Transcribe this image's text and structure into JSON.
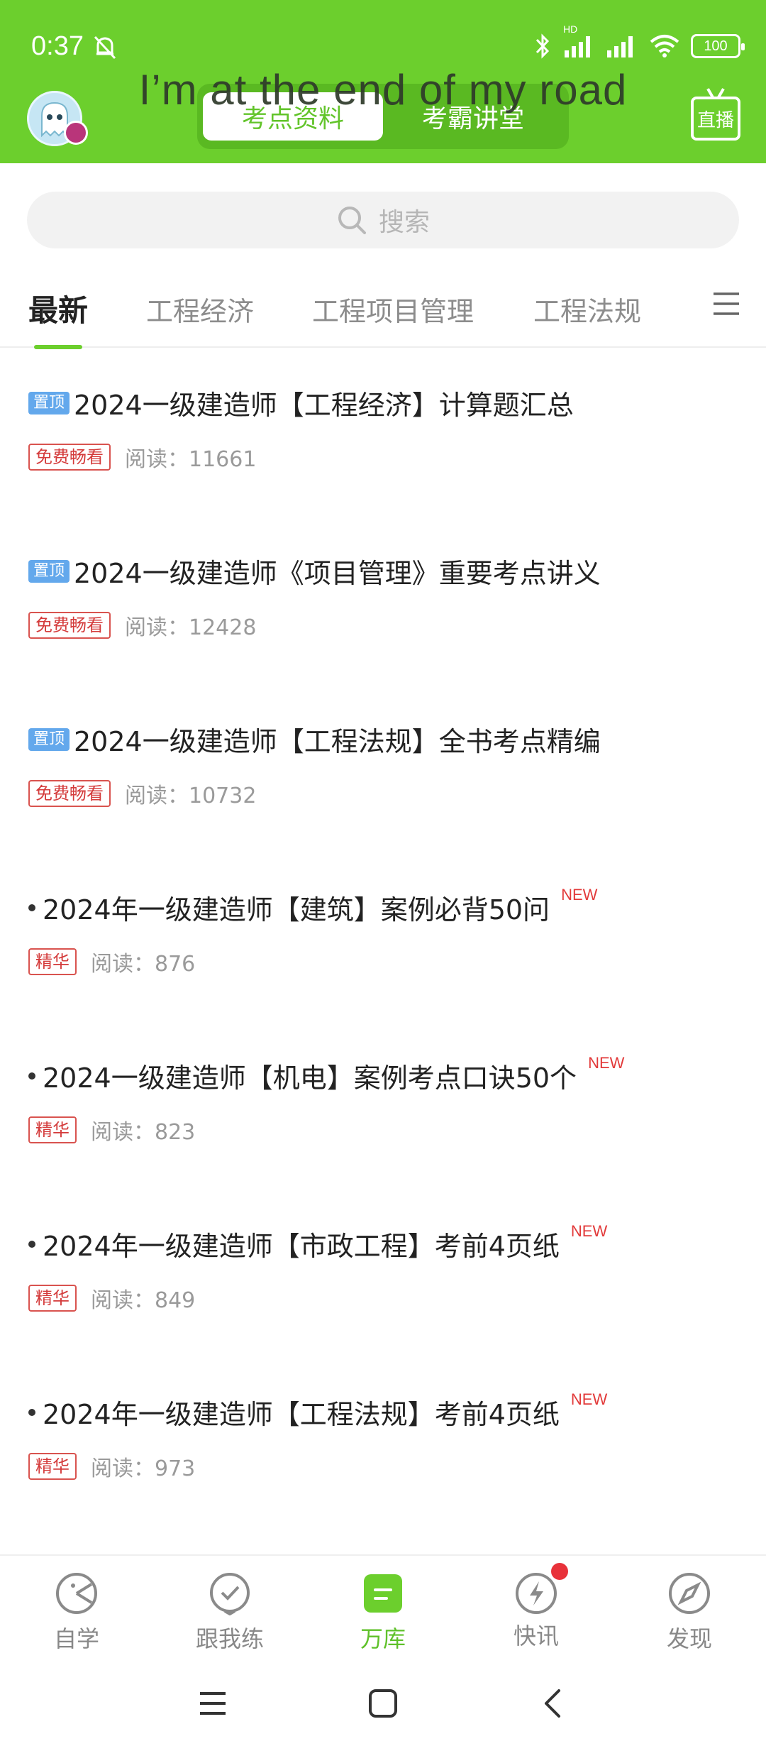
{
  "status_bar": {
    "time": "0:37",
    "signal_label": "HD",
    "battery": "100"
  },
  "header": {
    "lyric_overlay": "I’m at the end of my road",
    "segments": [
      {
        "label": "考点资料",
        "active": true
      },
      {
        "label": "考霸讲堂",
        "active": false
      }
    ],
    "live_label": "直播",
    "colors": {
      "header_bg": "#6ccf2d",
      "segment_active_text": "#62c42a"
    }
  },
  "search": {
    "placeholder": "搜索"
  },
  "category_tabs": [
    {
      "label": "最新",
      "active": true
    },
    {
      "label": "工程经济",
      "active": false
    },
    {
      "label": "工程项目管理",
      "active": false
    },
    {
      "label": "工程法规",
      "active": false
    }
  ],
  "articles": [
    {
      "pin": "置顶",
      "title": "2024一级建造师【工程经济】计算题汇总",
      "tag": "免费畅看",
      "reads": "阅读：11661",
      "is_new": false
    },
    {
      "pin": "置顶",
      "title": "2024一级建造师《项目管理》重要考点讲义",
      "tag": "免费畅看",
      "reads": "阅读：12428",
      "is_new": false
    },
    {
      "pin": "置顶",
      "title": "2024一级建造师【工程法规】全书考点精编",
      "tag": "免费畅看",
      "reads": "阅读：10732",
      "is_new": false
    },
    {
      "pin": "",
      "title": "2024年一级建造师【建筑】案例必背50问",
      "tag": "精华",
      "reads": "阅读：876",
      "is_new": true,
      "new_label": "NEW"
    },
    {
      "pin": "",
      "title": "2024一级建造师【机电】案例考点口诀50个",
      "tag": "精华",
      "reads": "阅读：823",
      "is_new": true,
      "new_label": "NEW"
    },
    {
      "pin": "",
      "title": "2024年一级建造师【市政工程】考前4页纸",
      "tag": "精华",
      "reads": "阅读：849",
      "is_new": true,
      "new_label": "NEW"
    },
    {
      "pin": "",
      "title": "2024年一级建造师【工程法规】考前4页纸",
      "tag": "精华",
      "reads": "阅读：973",
      "is_new": true,
      "new_label": "NEW"
    }
  ],
  "bottom_nav": [
    {
      "label": "自学",
      "icon": "self-study-icon",
      "active": false
    },
    {
      "label": "跟我练",
      "icon": "practice-icon",
      "active": false
    },
    {
      "label": "万库",
      "icon": "library-icon",
      "active": true
    },
    {
      "label": "快讯",
      "icon": "flash-news-icon",
      "active": false,
      "badge": true
    },
    {
      "label": "发现",
      "icon": "compass-icon",
      "active": false
    }
  ],
  "accent_color": "#5fc12a"
}
